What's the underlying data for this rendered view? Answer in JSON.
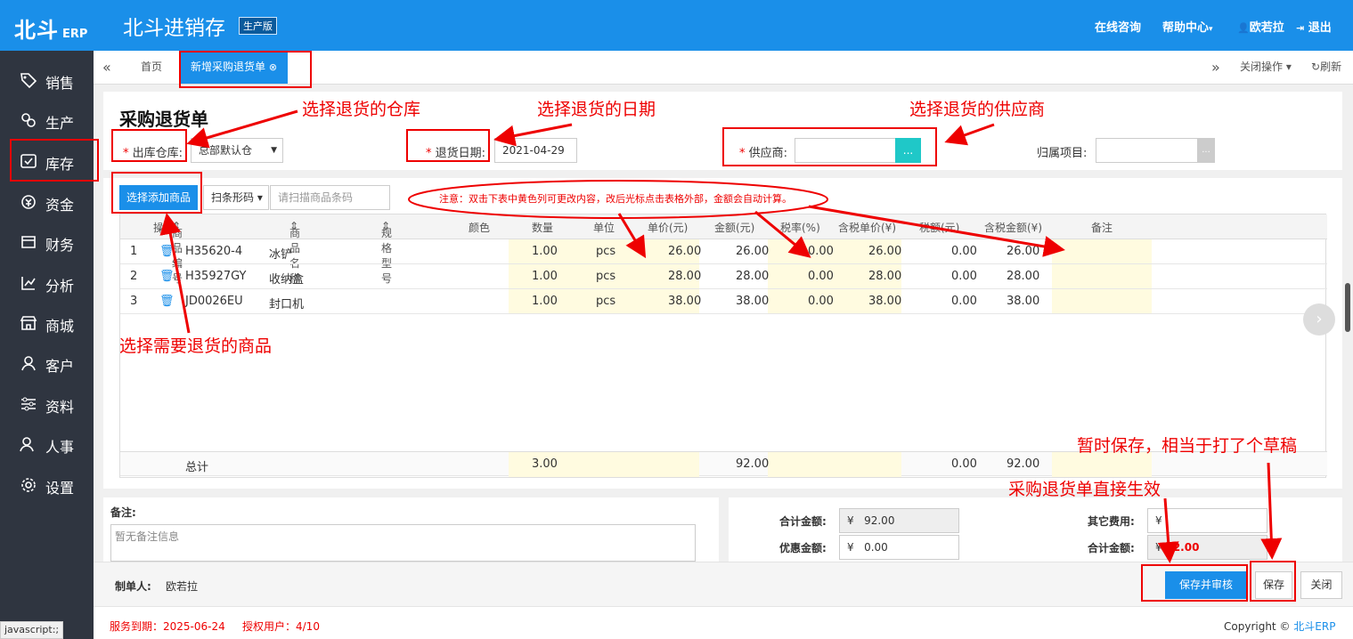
{
  "header": {
    "logo": "北斗",
    "logo_sub": "ERP",
    "title": "北斗进销存",
    "edition": "生产版",
    "links": {
      "consult": "在线咨询",
      "help": "帮助中心",
      "user": "欧若拉",
      "logout": "退出"
    }
  },
  "sidebar": {
    "items": [
      {
        "label": "销售",
        "icon": "tag-icon"
      },
      {
        "label": "生产",
        "icon": "gears-icon"
      },
      {
        "label": "库存",
        "icon": "inventory-icon"
      },
      {
        "label": "资金",
        "icon": "money-icon"
      },
      {
        "label": "财务",
        "icon": "ledger-icon"
      },
      {
        "label": "分析",
        "icon": "chart-icon"
      },
      {
        "label": "商城",
        "icon": "store-icon"
      },
      {
        "label": "客户",
        "icon": "user-icon"
      },
      {
        "label": "资料",
        "icon": "sliders-icon"
      },
      {
        "label": "人事",
        "icon": "people-icon"
      },
      {
        "label": "设置",
        "icon": "gear-icon"
      }
    ]
  },
  "tabs": {
    "home": "首页",
    "active": "新增采购退货单",
    "close_ops": "关闭操作",
    "refresh": "刷新"
  },
  "form": {
    "title": "采购退货单",
    "warehouse_label": "出库仓库:",
    "warehouse_value": "总部默认仓",
    "date_label": "退货日期:",
    "date_value": "2021-04-29",
    "supplier_label": "供应商:",
    "supplier_btn": "...",
    "project_label": "归属项目:",
    "project_btn": "..."
  },
  "toolbar": {
    "add_goods": "选择添加商品",
    "barcode": "扫条形码",
    "barcode_placeholder": "请扫描商品条码",
    "notice": "注意：双击下表中黄色列可更改内容，改后光标点击表格外部，金额会自动计算。"
  },
  "grid": {
    "columns": [
      "操作",
      "商品编号",
      "商品名称",
      "规格型号",
      "颜色",
      "数量",
      "单位",
      "单价(元)",
      "金额(元)",
      "税率(%)",
      "含税单价(¥)",
      "税额(元)",
      "含税金额(¥)",
      "备注"
    ],
    "rows": [
      {
        "idx": "1",
        "code": "H35620-4",
        "name": "冰铲",
        "qty": "1.00",
        "unit": "pcs",
        "price": "26.00",
        "amount": "26.00",
        "tax_rate": "0.00",
        "tax_price": "26.00",
        "tax": "0.00",
        "tax_amount": "26.00"
      },
      {
        "idx": "2",
        "code": "H35927GY",
        "name": "收纳盒",
        "qty": "1.00",
        "unit": "pcs",
        "price": "28.00",
        "amount": "28.00",
        "tax_rate": "0.00",
        "tax_price": "28.00",
        "tax": "0.00",
        "tax_amount": "28.00"
      },
      {
        "idx": "3",
        "code": "JD0026EU",
        "name": "封口机",
        "qty": "1.00",
        "unit": "pcs",
        "price": "38.00",
        "amount": "38.00",
        "tax_rate": "0.00",
        "tax_price": "38.00",
        "tax": "0.00",
        "tax_amount": "38.00"
      }
    ],
    "total": {
      "label": "总计",
      "qty": "3.00",
      "amount": "92.00",
      "tax": "0.00",
      "tax_amount": "92.00"
    }
  },
  "remarks": {
    "label": "备注:",
    "placeholder": "暂无备注信息"
  },
  "totals": {
    "total_label": "合计金额:",
    "currency": "¥",
    "total_value": "92.00",
    "discount_label": "优惠金额:",
    "discount_value": "0.00",
    "other_label": "其它费用:",
    "grand_label": "合计金额:",
    "grand_value": "92.00"
  },
  "footer": {
    "maker_label": "制单人:",
    "maker": "欧若拉",
    "save_audit": "保存并审核",
    "save": "保存",
    "close": "关闭"
  },
  "status": {
    "expire": "服务到期：2025-06-24",
    "license": "授权用户：4/10",
    "copyright": "Copyright ©",
    "brand": "北斗ERP",
    "js": "javascript:;"
  },
  "annotations": {
    "warehouse": "选择退货的仓库",
    "date": "选择退货的日期",
    "supplier": "选择退货的供应商",
    "goods": "选择需要退货的商品",
    "draft": "暂时保存，相当于打了个草稿",
    "effective": "采购退货单直接生效"
  },
  "colors": {
    "brand": "#1a8fe9",
    "sidebar": "#2f3540",
    "annotation": "#e00000"
  }
}
